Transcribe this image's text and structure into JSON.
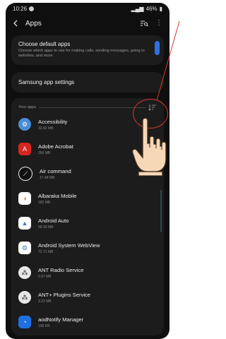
{
  "status_bar": {
    "time": "10:26",
    "battery": "46%"
  },
  "app_bar": {
    "title": "Apps"
  },
  "default_apps": {
    "title": "Choose default apps",
    "description": "Choose which apps to use for making calls, sending messages, going to websites, and more."
  },
  "samsung_settings": {
    "title": "Samsung app settings"
  },
  "your_apps": {
    "header": "Your apps",
    "items": [
      {
        "name": "Accessibility",
        "size": "32.82 MB",
        "icon": "gear-icon",
        "color": "#4a8fd6"
      },
      {
        "name": "Adobe Acrobat",
        "size": "266 MB",
        "icon": "acrobat-icon",
        "color": "#d6261f"
      },
      {
        "name": "Air command",
        "size": "17.48 MB",
        "icon": "pen-icon",
        "color": "#2a2a2a"
      },
      {
        "name": "Albaraka Mobile",
        "size": "182 MB",
        "icon": "albaraka-icon",
        "color": "#e56a24"
      },
      {
        "name": "Android Auto",
        "size": "58.39 MB",
        "icon": "android-auto-icon",
        "color": "#3a7bd5"
      },
      {
        "name": "Android System WebView",
        "size": "72.71 MB",
        "icon": "settings-gear-icon",
        "color": "#3a78c8"
      },
      {
        "name": "ANT Radio Service",
        "size": "0.97 MB",
        "icon": "ant-icon",
        "color": "#555555"
      },
      {
        "name": "ANT+ Plugins Service",
        "size": "3.22 MB",
        "icon": "ant-plus-icon",
        "color": "#555555"
      },
      {
        "name": "aodNotify Manager",
        "size": "158 KB",
        "icon": "aod-icon",
        "color": "#1e6fe0"
      }
    ]
  }
}
